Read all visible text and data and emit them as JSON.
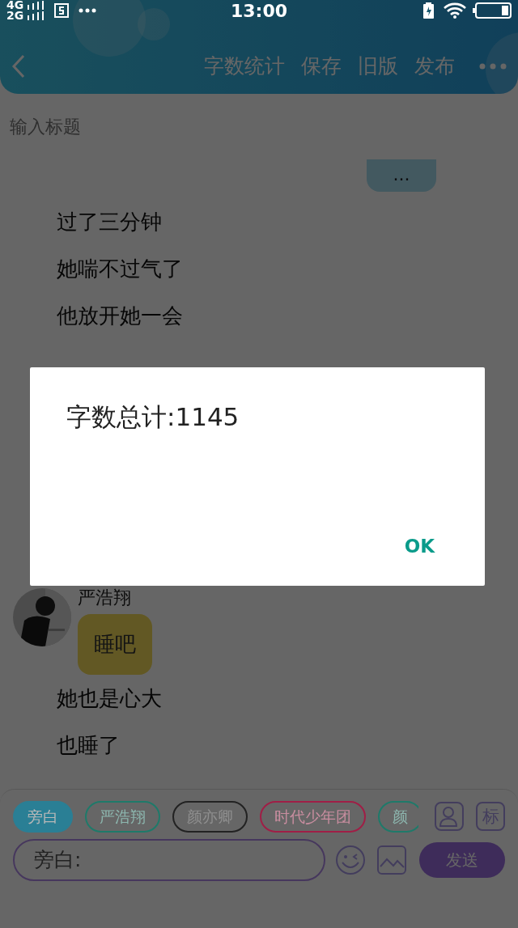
{
  "status_bar": {
    "network_top": "4G",
    "network_bottom": "2G",
    "time": "13:00"
  },
  "header": {
    "actions": [
      "字数统计",
      "保存",
      "旧版",
      "发布"
    ]
  },
  "title_field": {
    "placeholder": "输入标题"
  },
  "messages": [
    {
      "kind": "bubble_right",
      "text": "..."
    },
    {
      "kind": "narration",
      "text": "过了三分钟"
    },
    {
      "kind": "narration",
      "text": "她喘不过气了"
    },
    {
      "kind": "narration",
      "text": "他放开她一会"
    },
    {
      "kind": "character",
      "name": "严浩翔",
      "text": "睡吧"
    },
    {
      "kind": "narration",
      "text": "她也是心大"
    },
    {
      "kind": "narration",
      "text": "也睡了"
    }
  ],
  "dialog": {
    "message": "字数总计:1145",
    "button": "OK"
  },
  "roles": [
    {
      "label": "旁白",
      "selected": true,
      "color": "#2a7f95"
    },
    {
      "label": "严浩翔",
      "selected": false,
      "color": "#1e7a6a"
    },
    {
      "label": "颜亦卿",
      "selected": false,
      "color": "#222222"
    },
    {
      "label": "时代少年团",
      "selected": false,
      "color": "#a01e46"
    },
    {
      "label": "颜",
      "selected": false,
      "color": "#1e7a6a"
    }
  ],
  "tag_button": "标",
  "input": {
    "placeholder": "旁白:"
  },
  "send_button": "发送"
}
